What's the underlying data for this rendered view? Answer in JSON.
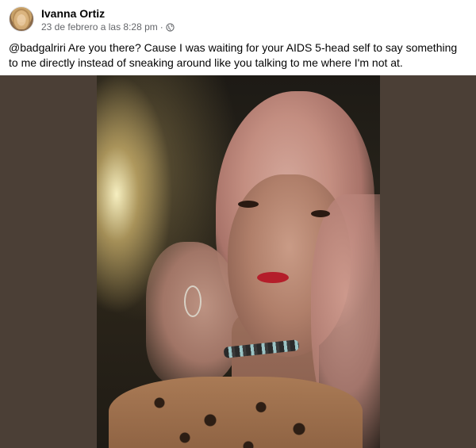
{
  "post": {
    "author": {
      "name": "Ivanna Ortiz",
      "avatar_icon": "profile-photo"
    },
    "timestamp": "23 de febrero a las 8:28 pm",
    "separator": "·",
    "audience_icon": "globe-icon",
    "text": "@badgalriri Are you there? Cause I was waiting for your AIDS 5-head self to say something to me directly instead of sneaking around like you talking to me where I'm not at.",
    "colors": {
      "media_background": "#4b3f36",
      "name_color": "#050505",
      "meta_color": "#65676b"
    }
  }
}
